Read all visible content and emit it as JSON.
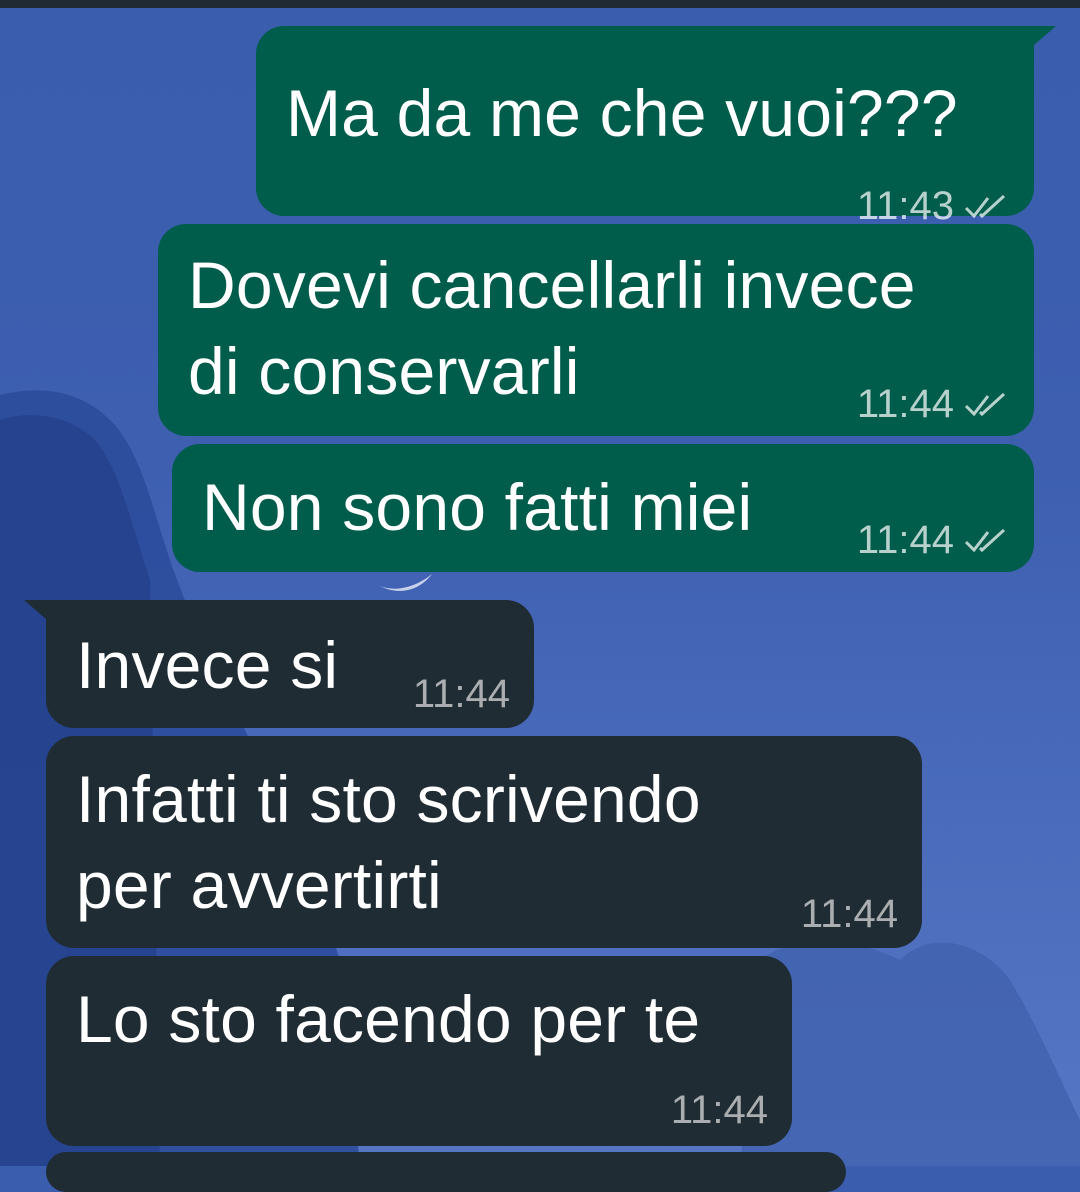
{
  "messages": [
    {
      "direction": "outgoing",
      "text": "Ma da me che vuoi???",
      "time": "11:43",
      "status": "read-ticks-icon"
    },
    {
      "direction": "outgoing",
      "text": "Dovevi cancellarli invece\ndi conservarli",
      "time": "11:44",
      "status": "read-ticks-icon"
    },
    {
      "direction": "outgoing",
      "text": "Non sono fatti miei",
      "time": "11:44",
      "status": "read-ticks-icon"
    },
    {
      "direction": "incoming",
      "text": "Invece si",
      "time": "11:44"
    },
    {
      "direction": "incoming",
      "text": "Infatti ti sto scrivendo\nper avvertirti",
      "time": "11:44"
    },
    {
      "direction": "incoming",
      "text": "Lo sto facendo per te",
      "time": "11:44"
    }
  ],
  "colors": {
    "outgoing_bubble": "#005c4b",
    "incoming_bubble": "#202c33",
    "wallpaper": "#3e5fb0",
    "text": "#ffffff"
  }
}
